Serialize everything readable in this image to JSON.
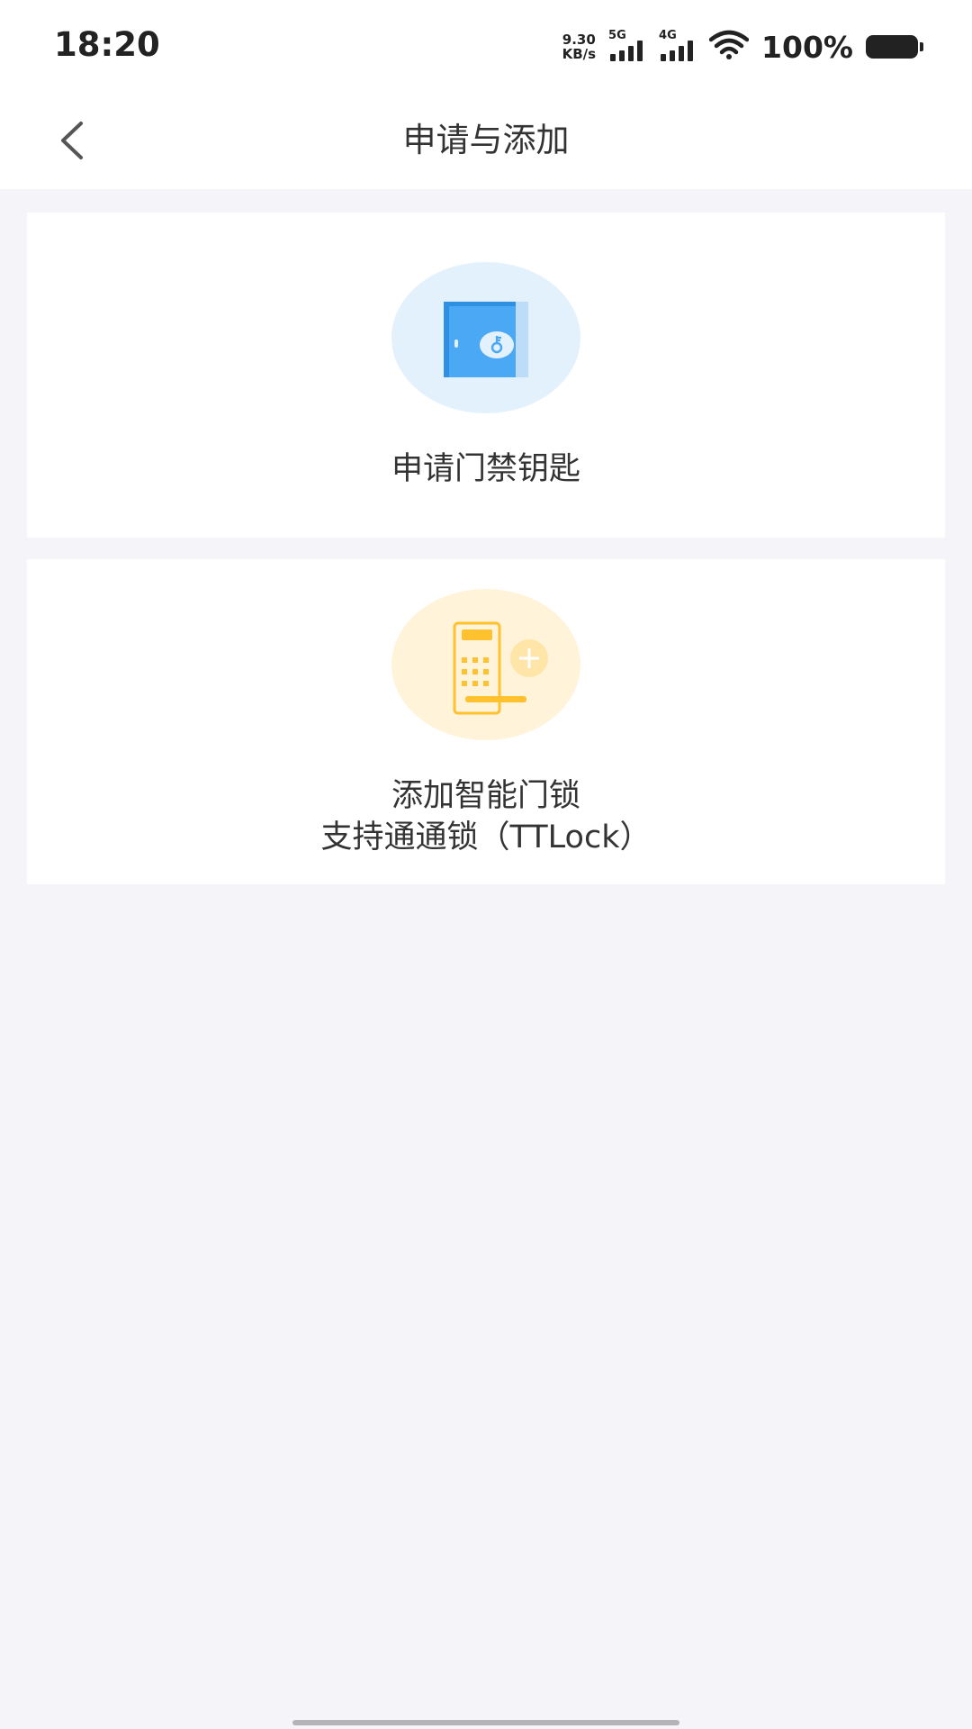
{
  "status_bar": {
    "time": "18:20",
    "net_speed_value": "9.30",
    "net_speed_unit": "KB/s",
    "signal_1_label": "5G",
    "signal_2_label": "4G",
    "battery_percent": "100%"
  },
  "header": {
    "title": "申请与添加",
    "back_icon": "chevron-left-icon"
  },
  "cards": [
    {
      "label": "申请门禁钥匙",
      "icon": "door-key-icon",
      "accent": "#4aa8f5"
    },
    {
      "label_line1": "添加智能门锁",
      "label_line2": "支持通通锁（TTLock）",
      "icon": "smart-lock-add-icon",
      "accent": "#ffc12e"
    }
  ]
}
